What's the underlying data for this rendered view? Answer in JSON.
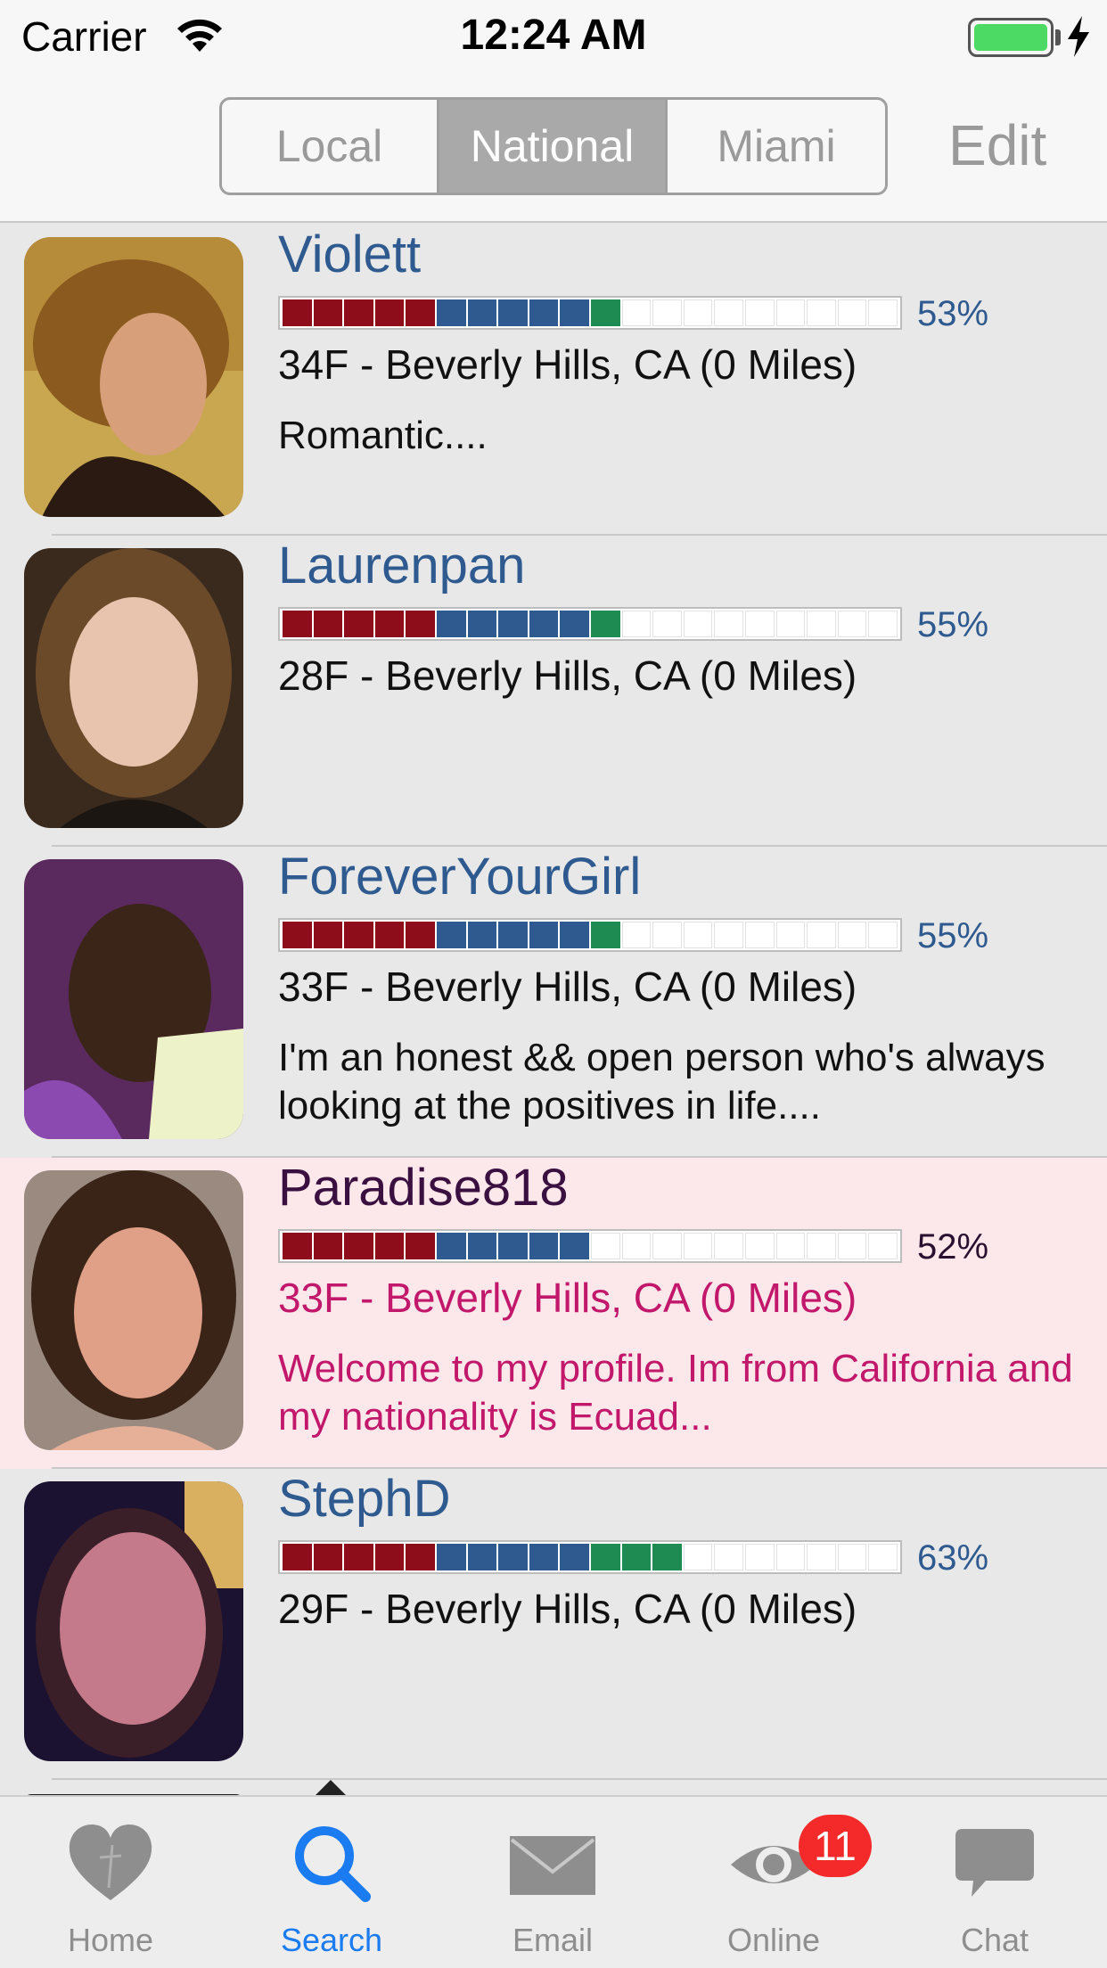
{
  "status_bar": {
    "carrier": "Carrier",
    "time": "12:24 AM"
  },
  "nav": {
    "segments": [
      "Local",
      "National",
      "Miami"
    ],
    "selected_segment": "National",
    "edit_label": "Edit"
  },
  "profiles": [
    {
      "name": "Violett",
      "match_percent": "53%",
      "details": "34F - Beverly Hills, CA (0 Miles)",
      "bio": "Romantic....",
      "highlighted": false
    },
    {
      "name": "Laurenpan",
      "match_percent": "55%",
      "details": "28F - Beverly Hills, CA (0 Miles)",
      "bio": "",
      "highlighted": false
    },
    {
      "name": "ForeverYourGirl",
      "match_percent": "55%",
      "details": "33F - Beverly Hills, CA (0 Miles)",
      "bio": "I'm an honest && open person who's always looking at the positives in life....",
      "highlighted": false
    },
    {
      "name": "Paradise818",
      "match_percent": "52%",
      "details": "33F - Beverly Hills, CA (0 Miles)",
      "bio": "Welcome to my profile. Im from California and my nationality is Ecuad...",
      "highlighted": true
    },
    {
      "name": "StephD",
      "match_percent": "63%",
      "details": "29F - Beverly Hills, CA (0 Miles)",
      "bio": "",
      "highlighted": false
    }
  ],
  "tab_bar": {
    "tabs": [
      {
        "label": "Home",
        "icon": "heart-icon"
      },
      {
        "label": "Search",
        "icon": "search-icon"
      },
      {
        "label": "Email",
        "icon": "envelope-icon"
      },
      {
        "label": "Online",
        "icon": "eye-icon"
      },
      {
        "label": "Chat",
        "icon": "chat-bubble-icon"
      }
    ],
    "active_tab": "Search",
    "online_badge": "11"
  },
  "colors": {
    "accent": "#1a7cf0",
    "name_blue": "#2e5a8f",
    "meter_red": "#8e0d1a",
    "meter_blue": "#2e5a8f",
    "meter_green": "#1e8c52",
    "highlight_bg": "#fce7ea",
    "highlight_text": "#c2186b",
    "badge_red": "#f42a2a"
  }
}
